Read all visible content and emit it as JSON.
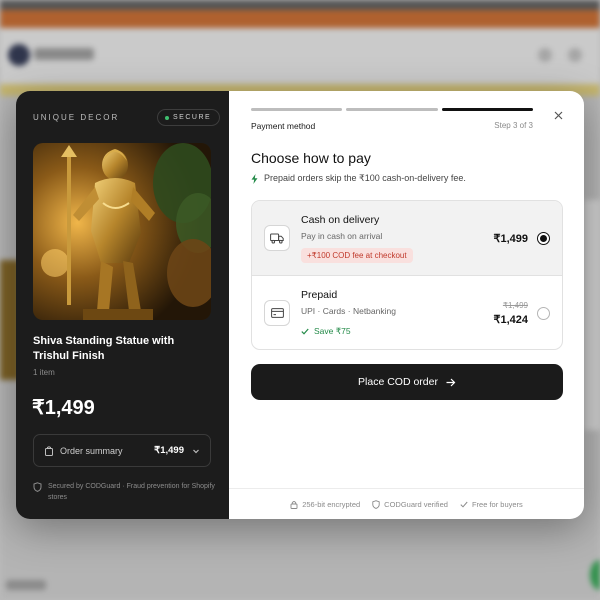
{
  "left_panel": {
    "brand": "UNIQUE DECOR",
    "secure_badge": "SECURE",
    "product_name": "Shiva Standing Statue with Trishul Finish",
    "item_count": "1 item",
    "price": "₹1,499",
    "order_summary": {
      "label": "Order summary",
      "price": "₹1,499"
    },
    "secured_note": "Secured by CODGuard · Fraud prevention for Shopify stores"
  },
  "right_panel": {
    "step_label": "Payment method",
    "step_count": "Step 3 of 3",
    "title": "Choose how to pay",
    "subtitle": "Prepaid orders skip the ₹100 cash-on-delivery fee.",
    "options": [
      {
        "title": "Cash on delivery",
        "subtitle": "Pay in cash on arrival",
        "tag": "+₹100 COD fee at checkout",
        "price": "₹1,499",
        "selected": true,
        "icon": "truck-icon"
      },
      {
        "title": "Prepaid",
        "subtitle": "UPI · Cards · Netbanking",
        "tag": "Save ₹75",
        "old_price": "₹1,499",
        "price": "₹1,424",
        "selected": false,
        "icon": "card-icon"
      }
    ],
    "cta": "Place COD order",
    "footer": [
      "256-bit encrypted",
      "CODGuard verified",
      "Free for buyers"
    ]
  },
  "colors": {
    "dark_panel": "#1c1c1c",
    "accent_green": "#238a48",
    "fee_red": "#c0392b",
    "fee_bg": "#f9e0de",
    "cta_bg": "#1b1b1b"
  }
}
